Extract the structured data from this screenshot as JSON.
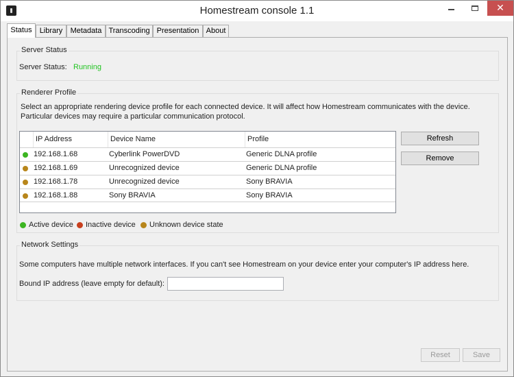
{
  "window": {
    "title": "Homestream console 1.1"
  },
  "tabs": [
    {
      "label": "Status"
    },
    {
      "label": "Library"
    },
    {
      "label": "Metadata"
    },
    {
      "label": "Transcoding"
    },
    {
      "label": "Presentation"
    },
    {
      "label": "About"
    }
  ],
  "server_status": {
    "group_title": "Server Status",
    "label": "Server Status:",
    "value": "Running",
    "value_color": "#22c322"
  },
  "renderer": {
    "group_title": "Renderer Profile",
    "description_line1": "Select an appropriate rendering device profile for each connected device. It will affect how Homestream communicates with the device.",
    "description_line2": "Particular devices may require a particular communication protocol.",
    "columns": [
      "IP Address",
      "Device Name",
      "Profile"
    ],
    "rows": [
      {
        "ip": "192.168.1.68",
        "device": "Cyberlink PowerDVD",
        "profile": "Generic DLNA profile",
        "state": "active"
      },
      {
        "ip": "192.168.1.69",
        "device": "Unrecognized device",
        "profile": "Generic DLNA profile",
        "state": "unknown"
      },
      {
        "ip": "192.168.1.78",
        "device": "Unrecognized device",
        "profile": "Sony BRAVIA",
        "state": "unknown"
      },
      {
        "ip": "192.168.1.88",
        "device": "Sony BRAVIA",
        "profile": "Sony BRAVIA",
        "state": "unknown"
      }
    ],
    "refresh_label": "Refresh",
    "remove_label": "Remove",
    "legend": {
      "active": "Active device",
      "inactive": "Inactive device",
      "unknown": "Unknown device state"
    },
    "colors": {
      "active": "#3cb521",
      "inactive": "#c8401e",
      "unknown": "#b8861b"
    }
  },
  "network": {
    "group_title": "Network Settings",
    "description": "Some computers have multiple network interfaces. If you can't see Homestream on your device enter your computer's IP address here.",
    "bound_ip_label": "Bound IP address (leave empty for default):",
    "bound_ip_value": ""
  },
  "footer": {
    "reset_label": "Reset",
    "save_label": "Save"
  }
}
